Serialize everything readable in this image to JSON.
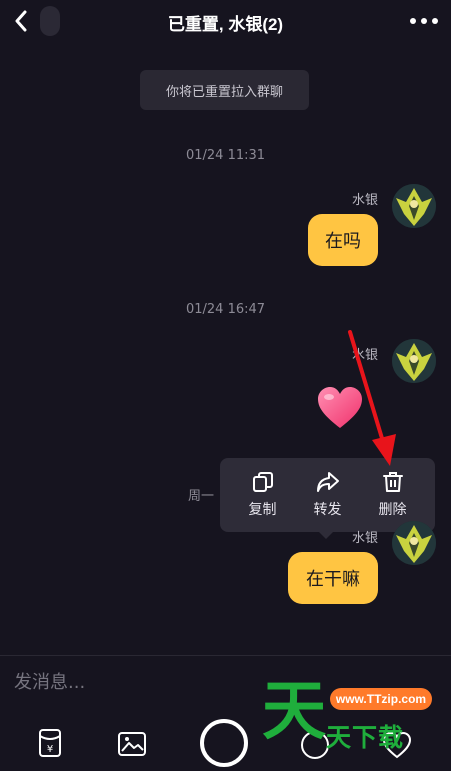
{
  "header": {
    "title": "已重置, 水银(2)"
  },
  "system_message": "你将已重置拉入群聊",
  "messages": [
    {
      "time": "01/24 11:31",
      "sender": "水银",
      "text": "在吗"
    },
    {
      "time": "01/24 16:47",
      "sender": "水银",
      "text": ""
    },
    {
      "time": "周一",
      "sender": "水银",
      "text": "在干嘛"
    }
  ],
  "context_menu": {
    "copy": "复制",
    "forward": "转发",
    "delete": "删除"
  },
  "input": {
    "placeholder": "发消息..."
  },
  "watermark": {
    "logo_char": "天",
    "url": "www.TTzip.com",
    "name": "天下载"
  },
  "colors": {
    "background": "#16141f",
    "bubble": "#ffc542",
    "menu": "#2e2c38",
    "arrow": "#e8141b",
    "watermark_green": "#1fae3c",
    "watermark_orange": "#ff7a2a"
  },
  "icons": [
    "back-icon",
    "more-icon",
    "copy-icon",
    "forward-icon",
    "trash-icon",
    "heart-icon",
    "red-envelope-icon",
    "image-icon",
    "emoji-icon",
    "gift-icon"
  ]
}
